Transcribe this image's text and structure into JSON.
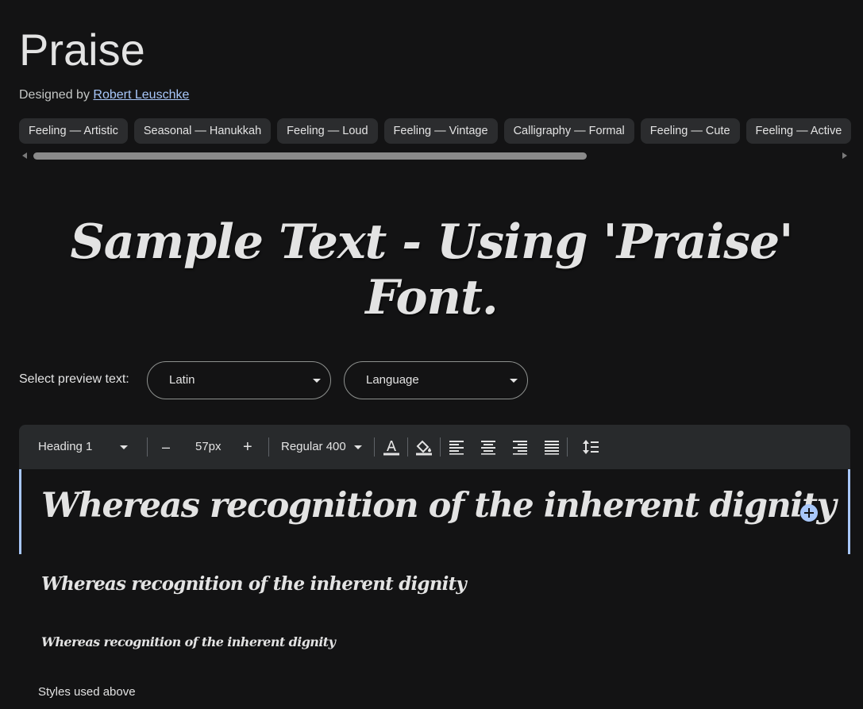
{
  "font": {
    "name": "Praise",
    "designed_by_prefix": "Designed by",
    "designer": "Robert Leuschke"
  },
  "tags": [
    "Feeling — Artistic",
    "Seasonal — Hanukkah",
    "Feeling — Loud",
    "Feeling — Vintage",
    "Calligraphy — Formal",
    "Feeling — Cute",
    "Feeling — Active"
  ],
  "sample_text": "Sample Text - Using 'Praise' Font.",
  "preview": {
    "label": "Select preview text:",
    "script_select": "Latin",
    "language_select": "Language"
  },
  "toolbar": {
    "style_select": "Heading 1",
    "decrease": "–",
    "size": "57px",
    "increase": "+",
    "weight_select": "Regular 400"
  },
  "preview_lines": [
    "Whereas recognition of the inherent dignity",
    "Whereas recognition of the inherent dignity",
    "Whereas recognition of the inherent dignity"
  ],
  "styles_used": "Styles used above",
  "colors": {
    "background": "#131314",
    "accent": "#a8c7fa",
    "chip": "#2b2c2e",
    "toolbar": "#282a2c"
  }
}
